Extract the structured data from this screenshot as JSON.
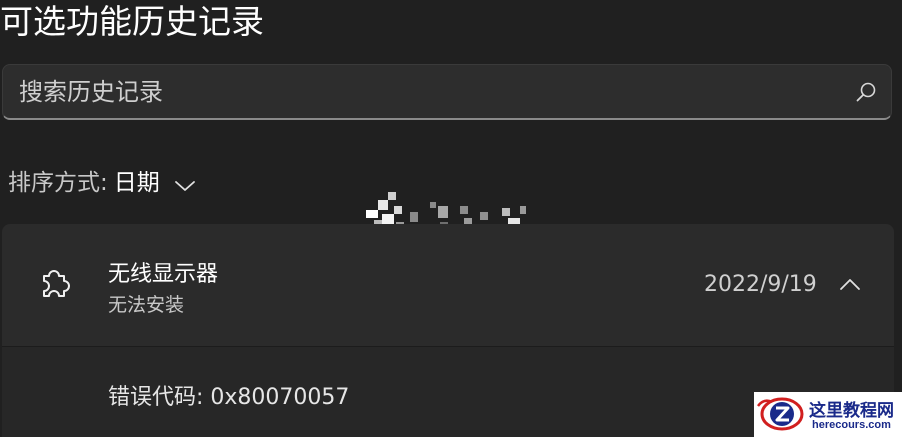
{
  "page": {
    "title": "可选功能历史记录"
  },
  "search": {
    "placeholder": "搜索历史记录",
    "icon": "search-icon"
  },
  "sort": {
    "label": "排序方式:",
    "value": "日期",
    "icon": "chevron-down-icon"
  },
  "history": {
    "items": [
      {
        "icon": "puzzle-piece-icon",
        "name": "无线显示器",
        "status": "无法安装",
        "date": "2022/9/19",
        "expanded": true,
        "detail": "错误代码: 0x80070057"
      }
    ]
  },
  "watermark": {
    "site_name": "这里教程网",
    "site_url": "herecours.com",
    "colors": {
      "text": "#1a2a8a",
      "accent": "#d11f1f"
    }
  },
  "colors": {
    "background": "#202020",
    "card_header": "#2b2b2b",
    "card_body": "#272727",
    "text_primary": "#ffffff",
    "text_secondary": "#c8c8c8"
  }
}
